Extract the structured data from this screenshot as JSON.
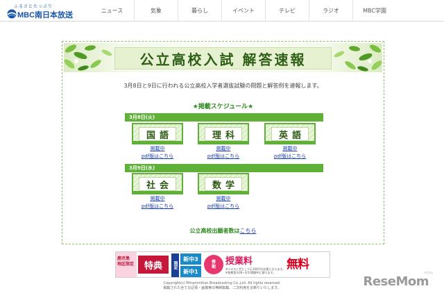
{
  "header": {
    "logo_tagline": "ふるさとたっぷり",
    "logo_name": "MBC南日本放送",
    "nav": [
      "ニュース",
      "気象",
      "暮らし",
      "イベント",
      "テレビ",
      "ラジオ",
      "MBC学園"
    ]
  },
  "banner": {
    "title": "公立高校入試 解答速報"
  },
  "intro": "3月8日と9日に行われる公立高校入学者選抜試験の問題と解答例を速報します。",
  "schedule_title": "★掲載スケジュール★",
  "days": [
    {
      "label": "3月8日(火)",
      "subjects": [
        {
          "name": "国語",
          "status": "掲載中",
          "pdf": "pdf版はこちら"
        },
        {
          "name": "理科",
          "status": "掲載中",
          "pdf": "pdf版はこちら"
        },
        {
          "name": "英語",
          "status": "掲載中",
          "pdf": "pdf版はこちら"
        }
      ]
    },
    {
      "label": "3月9日(水)",
      "subjects": [
        {
          "name": "社会",
          "status": "掲載中",
          "pdf": "pdf版はこちら"
        },
        {
          "name": "数学",
          "status": "掲載中",
          "pdf": "pdf版はこちら"
        }
      ]
    }
  ],
  "footer_link": {
    "text": "公立高校出願者数は",
    "link": "こちら"
  },
  "ad": {
    "region": "鹿児島\n地区限定",
    "tokuten": "特典",
    "gentei": "限定",
    "grade1": "新中3",
    "grade2": "新中1",
    "season": "春\n期",
    "fee": "授業料",
    "note": "※テキスト代として2,160円が必要となります。\n※各教室3/28~3/31期間中に限ります。",
    "muryo": "無料"
  },
  "copyright": {
    "line1": "Copyright(c) Minaminihon Broadcasting Co.,Ltd. All rights reserved.",
    "line2": "掲載された全ての記事・画像等の無断転載、二次利用をお断りいたします。"
  },
  "watermark": {
    "text": "ReseMom",
    "ruby": "リセマム"
  },
  "colors": {
    "accent_green": "#5fb038",
    "title_green": "#2e8a1e",
    "link_blue": "#1a3fb3",
    "brand_blue": "#1a56a8"
  }
}
